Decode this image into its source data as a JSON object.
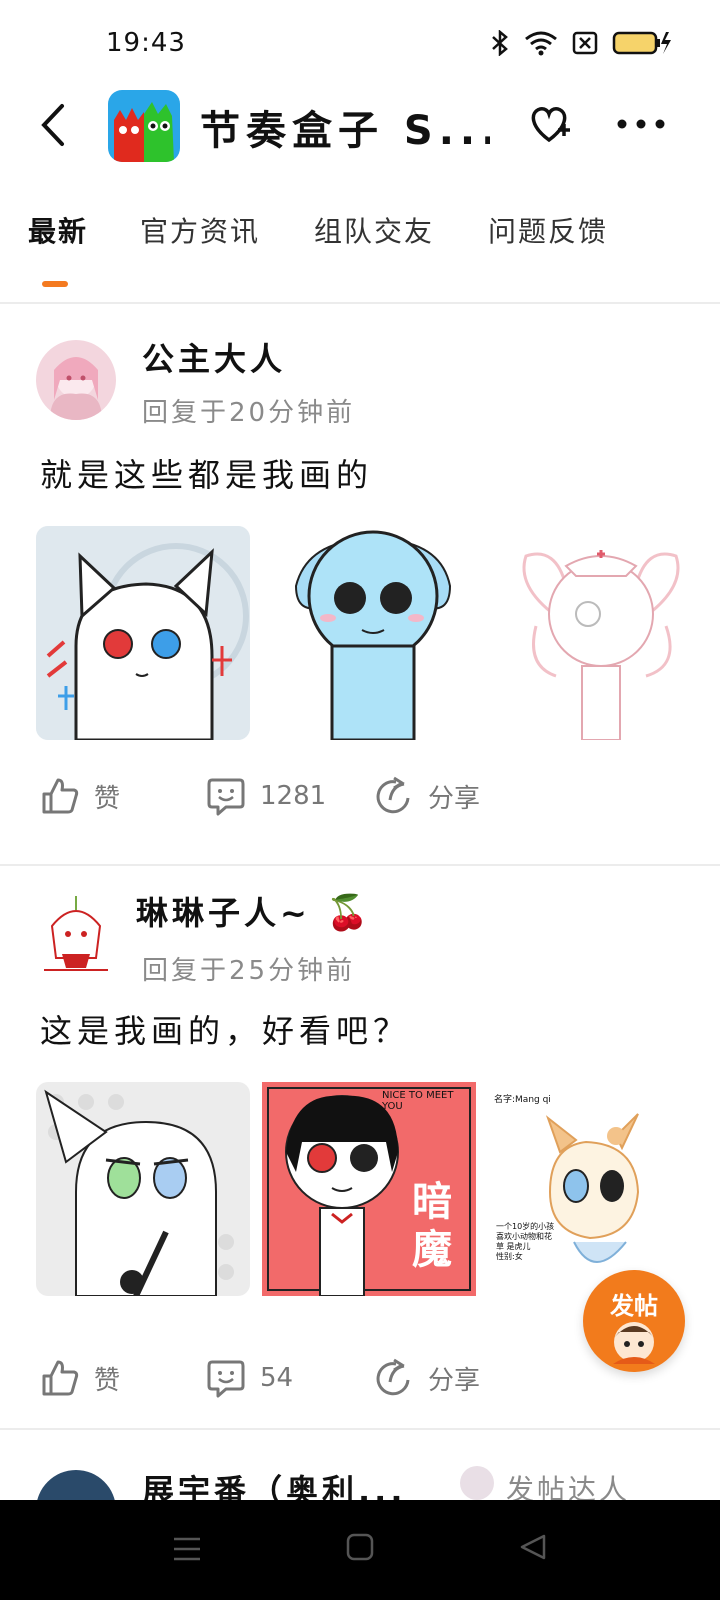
{
  "status": {
    "time": "19:43"
  },
  "header": {
    "title": "节奏盒子 S..."
  },
  "tabs": [
    {
      "label": "最新"
    },
    {
      "label": "官方资讯"
    },
    {
      "label": "组队交友"
    },
    {
      "label": "问题反馈"
    }
  ],
  "posts": [
    {
      "username": "公主大人",
      "meta": "回复于20分钟前",
      "content": "就是这些都是我画的",
      "like_label": "赞",
      "comment_count": "1281",
      "share_label": "分享"
    },
    {
      "username": "琳琳子人~",
      "username_emoji": "🍒",
      "meta": "回复于25分钟前",
      "content": "这是我画的，好看吧？",
      "like_label": "赞",
      "comment_count": "54",
      "share_label": "分享",
      "image2_caption_top": "NICE TO MEET YOU",
      "image2_caption_big": "暗魔",
      "image3_caption_top": "名字:Mang qi",
      "image3_caption_lines": [
        "一个10岁的小孩",
        "喜欢小动物和花",
        "草   是虎儿",
        "性别:女"
      ]
    },
    {
      "username": "展宇番（奥利...",
      "side_text": "发帖达人"
    }
  ],
  "fab": {
    "label": "发帖"
  },
  "colors": {
    "accent": "#f47a20"
  }
}
